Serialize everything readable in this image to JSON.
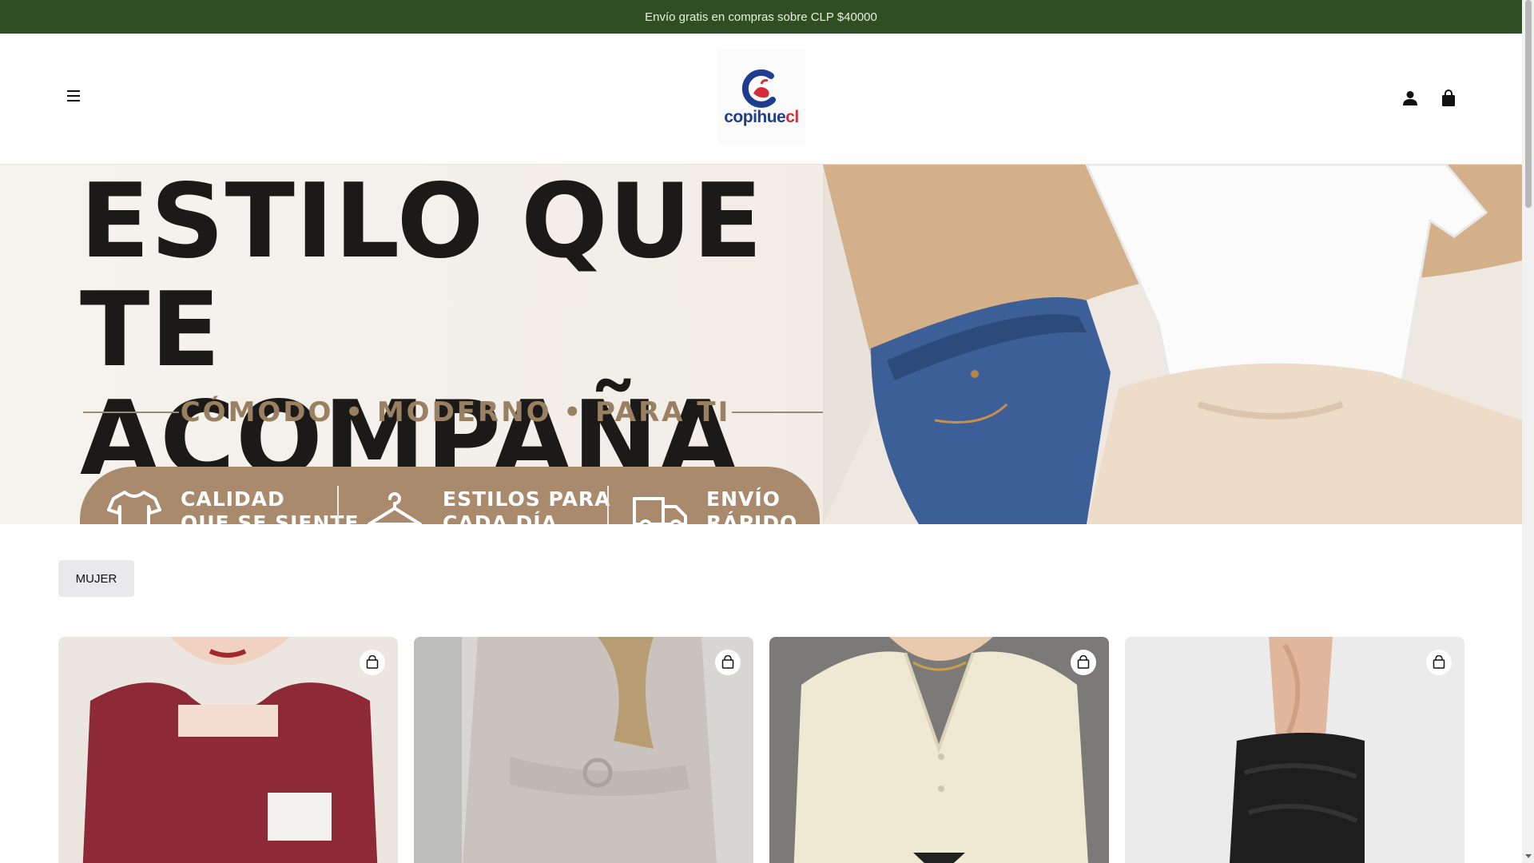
{
  "announcement": "Envío gratis en compras sobre CLP $40000",
  "header": {
    "logo_text_main": "copihue",
    "logo_text_accent": "cl",
    "menu_icon": "hamburger-menu-icon",
    "account_icon": "user-icon",
    "cart_icon": "shopping-bag-icon"
  },
  "hero": {
    "title_line1": "ESTILO QUE",
    "title_line2": "TE ACOMPAÑA",
    "subtitle": "CÓMODO • MODERNO • PARA TI",
    "features": [
      {
        "line1": "CALIDAD",
        "line2": "QUE SE SIENTE",
        "icon": "t-shirt-icon"
      },
      {
        "line1": "ESTILOS PARA",
        "line2": "CADA DÍA",
        "icon": "hanger-icon"
      },
      {
        "line1": "ENVÍO",
        "line2": "RÁPIDO",
        "icon": "delivery-truck-icon"
      }
    ]
  },
  "filters": {
    "active_chip": "MUJER"
  },
  "products": [
    {
      "name": "red ribbed top",
      "color": "#8e2a35"
    },
    {
      "name": "grey belted coat",
      "color": "#c9c3be"
    },
    {
      "name": "cream cardigan",
      "color": "#eee7d2"
    },
    {
      "name": "black slouch boots",
      "color": "#e6e6e6"
    }
  ],
  "colors": {
    "announcement_bg": "#2f4f22",
    "brand_blue": "#1f3d8f",
    "brand_red": "#d32f3a",
    "hero_pill": "#a98a6c"
  }
}
